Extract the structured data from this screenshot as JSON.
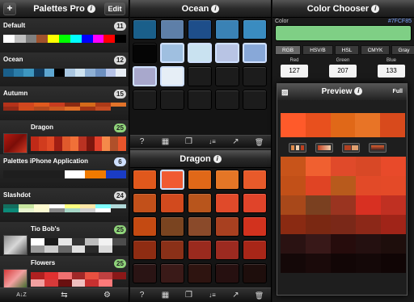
{
  "palettes_panel": {
    "title": "Palettes Pro",
    "add_label": "+",
    "edit_label": "Edit",
    "palettes": [
      {
        "name": "Default",
        "count": "11",
        "badge": "grey",
        "thumb": false,
        "colors": [
          "#ffffff",
          "#c0c0c0",
          "#808080",
          "#a0522d",
          "#ffff00",
          "#00ff00",
          "#00ffff",
          "#0000ff",
          "#ff00ff",
          "#ff0000",
          "#000000"
        ]
      },
      {
        "name": "Ocean",
        "count": "12",
        "badge": "grey",
        "thumb": false,
        "colors": [
          "#1a5f8a",
          "#2b7ca8",
          "#3e97c0",
          "#123a5c",
          "#5fa7d1",
          "#000000",
          "#a9c6e0",
          "#cfe3f0",
          "#8fb0d4",
          "#6c8fbf",
          "#b7c4e8",
          "#e8eef5"
        ]
      },
      {
        "name": "Autumn",
        "count": "15",
        "badge": "grey",
        "thumb": false,
        "colors": [
          "#b5321a",
          "#d1461f",
          "#e0591e",
          "#c73c1f",
          "#8a2a12",
          "#d56a1a",
          "#ac3a18",
          "#e2732a",
          "#962a17",
          "#d04a1c",
          "#b4491e",
          "#cc5820",
          "#e06d26",
          "#a33515",
          "#c54b22"
        ]
      },
      {
        "name": "Dragon",
        "count": "25",
        "badge": "green",
        "thumb": true,
        "thumb_colors": [
          "#b51a10",
          "#7a0d08",
          "#d43a22"
        ],
        "colors": [
          "#c02a18",
          "#d13c1e",
          "#e04a26",
          "#a11e13",
          "#e05a2c",
          "#f07038",
          "#b93222",
          "#7d160d",
          "#e2402b",
          "#f58a4a",
          "#b0502a",
          "#e9552b"
        ]
      },
      {
        "name": "Palettes iPhone Application",
        "count": "6",
        "badge": "blue",
        "thumb": false,
        "colors": [
          "#1e1e1e",
          "#1e1e1e",
          "#1e1e1e",
          "#ffffff",
          "#f07a00",
          "#1a3cc4"
        ]
      },
      {
        "name": "Slashdot",
        "count": "24",
        "badge": "grey",
        "thumb": false,
        "colors": [
          "#146e5e",
          "#c8e6a0",
          "#fffbd0",
          "#ffffff",
          "#ffff80",
          "#ffe8a8",
          "#80ffff",
          "#b0d8d8",
          "#0c8a78",
          "#e8f4d0",
          "#fafad2",
          "#888888",
          "#a8d8c8",
          "#d0d0d0",
          "#ffffff"
        ]
      },
      {
        "name": "Tio Bob's",
        "count": "25",
        "badge": "green",
        "thumb": true,
        "thumb_colors": [
          "#8a8a8a",
          "#d8d8d8",
          "#555555"
        ],
        "colors": [
          "#ffffff",
          "#1a1a1a",
          "#e6e6e6",
          "#333333",
          "#bdbdbd",
          "#f2f2f2",
          "#4d4d4d",
          "#999999",
          "#cccccc",
          "#666666",
          "#e0e0e0",
          "#2a2a2a",
          "#d9d9d9"
        ]
      },
      {
        "name": "Flowers",
        "count": "25",
        "badge": "green",
        "thumb": true,
        "thumb_colors": [
          "#d83a3a",
          "#f2a0a0",
          "#3a6a2a"
        ],
        "colors": [
          "#b02020",
          "#e03030",
          "#f07070",
          "#a02828",
          "#e85040",
          "#c04040",
          "#8a1818",
          "#f2a0a0",
          "#d83a3a",
          "#6a1010",
          "#f0c0c0",
          "#c83030",
          "#ff7a7a"
        ]
      }
    ],
    "toolbar": {
      "sort": "A↓Z",
      "swap": "⇆",
      "settings": "⚙"
    }
  },
  "ocean_panel": {
    "title": "Ocean",
    "colors": [
      "#1a5f8a",
      "#5e7fa8",
      "#1e4e8a",
      "#3a82b5",
      "#3a8cc0",
      "#050505",
      "#9fbfe0",
      "#c9e2f0",
      "#b8c4e4",
      "#88a8d8",
      "#a8a8cc",
      "#e6eef6",
      "#1c1c1c",
      "#1c1c1c",
      "#1c1c1c",
      "#1c1c1c",
      "#1c1c1c",
      "#1c1c1c",
      "#1c1c1c",
      "#1c1c1c"
    ],
    "selected": [
      6,
      7,
      8,
      9,
      10,
      11
    ]
  },
  "dragon_panel": {
    "title": "Dragon",
    "colors": [
      "#e0581c",
      "#f05a32",
      "#e06818",
      "#e47626",
      "#e85a2a",
      "#c2501a",
      "#d24a1e",
      "#b8551c",
      "#e04a2a",
      "#e0442a",
      "#c44a12",
      "#7a4420",
      "#8a4a2a",
      "#a84020",
      "#d2321e",
      "#8e2c12",
      "#8a3018",
      "#9a2a1e",
      "#9c2a20",
      "#a82618",
      "#2a1414",
      "#3a1a18",
      "#2e1410",
      "#261010",
      "#1e0e0c"
    ],
    "selected": [
      1
    ]
  },
  "toolbar_icons": {
    "help": "?",
    "qr": "▦",
    "copy": "❐",
    "sort": "↓≡",
    "share": "↗",
    "trash": "🗑"
  },
  "color_chooser": {
    "title": "Color Chooser",
    "color_label": "Color",
    "hex_value": "#7FCF85",
    "swatch_color": "#7fcf85",
    "tabs": [
      "RGB",
      "HSV/B",
      "HSL",
      "CMYK",
      "Gray"
    ],
    "active_tab": 0,
    "red_label": "Red",
    "red_value": "127",
    "green_label": "Green",
    "green_value": "207",
    "blue_label": "Blue",
    "blue_value": "133"
  },
  "preview": {
    "title": "Preview",
    "full_label": "Full",
    "top_strip": [
      "#ff5a2a",
      "#e8501e",
      "#e06818",
      "#e87426",
      "#d84a1c"
    ],
    "grid": [
      "#c8541a",
      "#f06030",
      "#e04a2a",
      "#d84826",
      "#e84a2a",
      "#c25018",
      "#e04424",
      "#b85a1c",
      "#e24a28",
      "#e44a28",
      "#a8481a",
      "#7a4020",
      "#9a3420",
      "#d83022",
      "#c03022",
      "#8a2a12",
      "#7a2812",
      "#7a2818",
      "#8c2818",
      "#a02418",
      "#2a1212",
      "#381818",
      "#260c0c",
      "#241010",
      "#1e0e0c",
      "#140808",
      "#1a0a0a",
      "#120606",
      "#140808",
      "#100505"
    ]
  }
}
